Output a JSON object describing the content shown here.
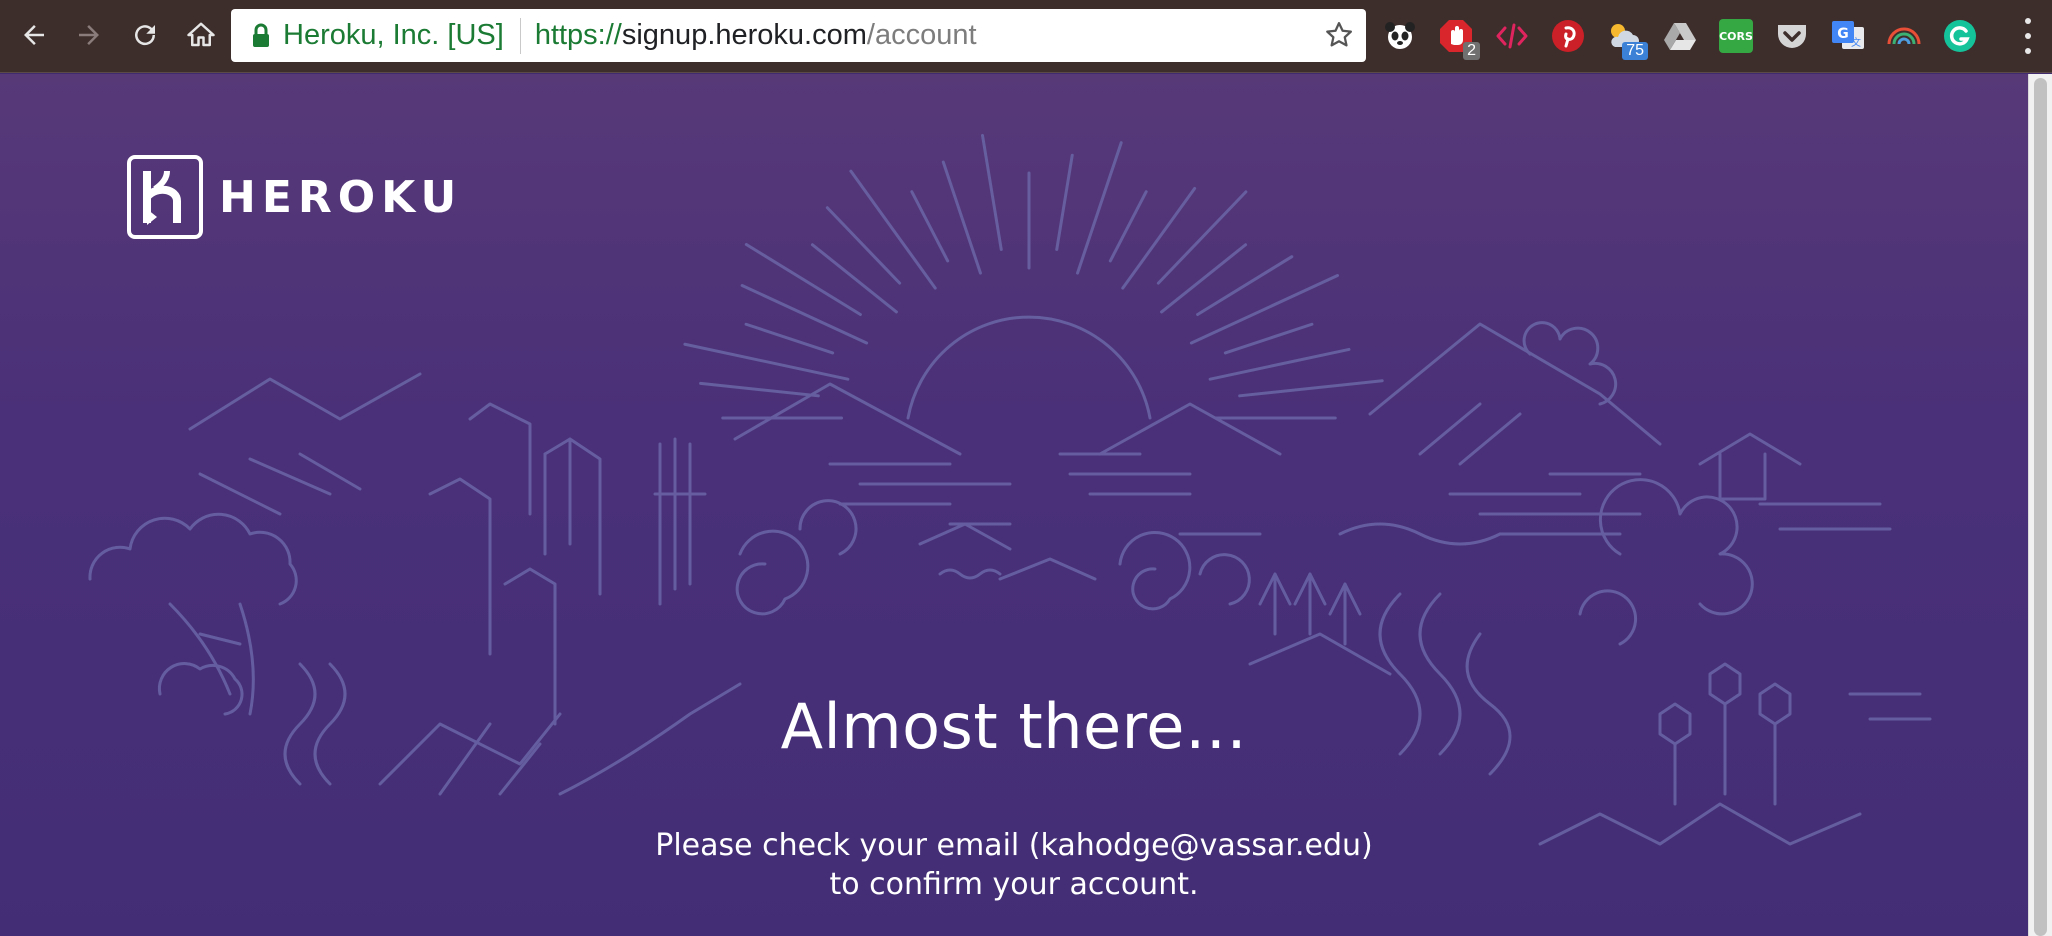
{
  "browser": {
    "security_org": "Heroku, Inc. [US]",
    "url": {
      "scheme": "https://",
      "host": "signup.heroku.com",
      "path": "/account"
    },
    "extensions": [
      {
        "name": "panda-extension-icon"
      },
      {
        "name": "adblock-extension-icon",
        "badge": "2",
        "badge_color": "#707070"
      },
      {
        "name": "code-extension-icon"
      },
      {
        "name": "pinterest-extension-icon"
      },
      {
        "name": "weather-extension-icon",
        "badge": "75",
        "badge_color": "#3b82d6"
      },
      {
        "name": "google-drive-extension-icon"
      },
      {
        "name": "cors-extension-icon",
        "label": "CORS"
      },
      {
        "name": "pocket-extension-icon"
      },
      {
        "name": "google-translate-extension-icon"
      },
      {
        "name": "rainbow-extension-icon"
      },
      {
        "name": "grammarly-extension-icon"
      }
    ]
  },
  "page": {
    "logo_text": "HEROKU",
    "headline": "Almost there…",
    "message_line1": "Please check your email (kahodge@vassar.edu)",
    "message_line2": "to confirm your account."
  },
  "colors": {
    "toolbar_bg": "#3d2d2b",
    "page_bg_top": "#573978",
    "page_bg_bottom": "#432e76",
    "illustration_line": "#6a66a6",
    "secure_green": "#1b7a33"
  }
}
